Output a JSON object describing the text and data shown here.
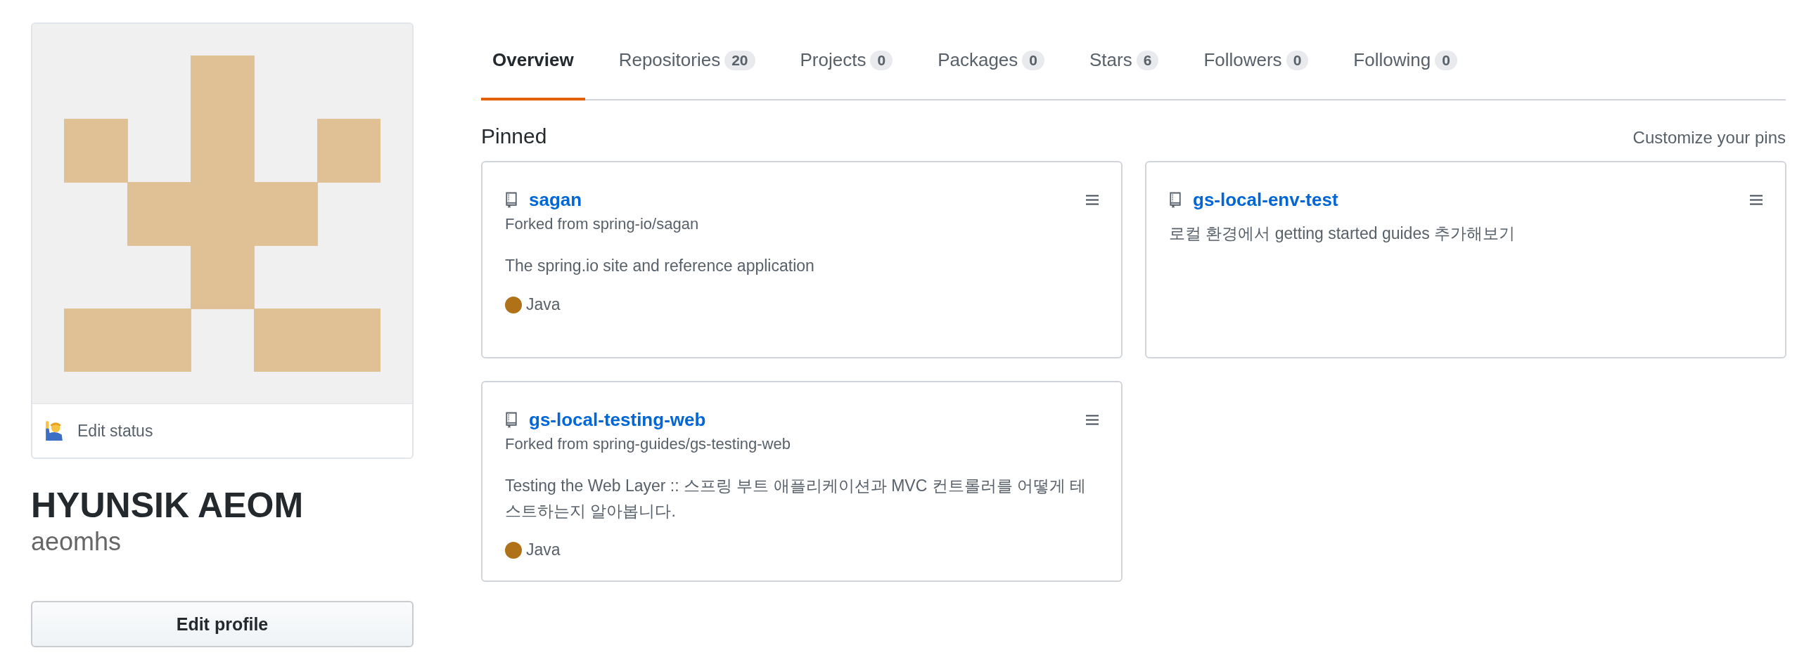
{
  "profile": {
    "status_label": "Edit status",
    "full_name": "HYUNSIK AEOM",
    "username": "aeomhs",
    "edit_button": "Edit profile"
  },
  "tabs": [
    {
      "label": "Overview",
      "selected": true
    },
    {
      "label": "Repositories",
      "count": "20",
      "selected": false
    },
    {
      "label": "Projects",
      "count": "0",
      "selected": false
    },
    {
      "label": "Packages",
      "count": "0",
      "selected": false
    },
    {
      "label": "Stars",
      "count": "6",
      "selected": false
    },
    {
      "label": "Followers",
      "count": "0",
      "selected": false
    },
    {
      "label": "Following",
      "count": "0",
      "selected": false
    }
  ],
  "pinned": {
    "title": "Pinned",
    "customize_link": "Customize your pins",
    "repos": [
      {
        "name": "sagan",
        "forked_from": "Forked from spring-io/sagan",
        "description": "The spring.io site and reference application",
        "language": "Java",
        "color": "#b07219"
      },
      {
        "name": "gs-local-env-test",
        "description": "로컬 환경에서 getting started guides 추가해보기"
      },
      {
        "name": "gs-local-testing-web",
        "forked_from": "Forked from spring-guides/gs-testing-web",
        "description": "Testing the Web Layer :: 스프링 부트 애플리케이션과 MVC 컨트롤러를 어떻게 테스트하는지 알아봅니다.",
        "language": "Java",
        "color": "#b07219"
      }
    ]
  }
}
